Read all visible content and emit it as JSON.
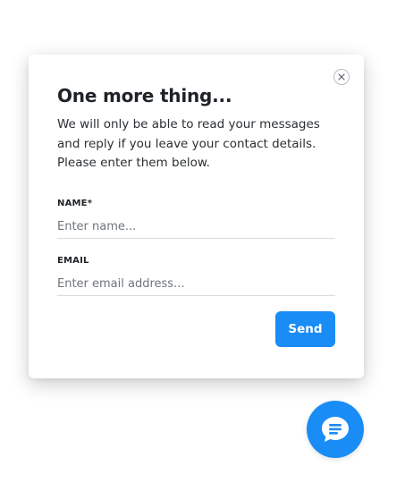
{
  "dialog": {
    "title": "One more thing...",
    "description": "We will only be able to read your messages and reply if you leave your contact details. Please enter them below.",
    "close_icon": "close-icon"
  },
  "form": {
    "name_label": "NAME*",
    "name_placeholder": "Enter name...",
    "name_value": "",
    "email_label": "EMAIL",
    "email_placeholder": "Enter email address...",
    "email_value": "",
    "send_label": "Send"
  },
  "launcher": {
    "icon": "chat-bubble-icon"
  },
  "colors": {
    "accent": "#1a8cf5",
    "text": "#1f2328",
    "placeholder": "#6f757b",
    "divider": "#d9dcdf"
  }
}
